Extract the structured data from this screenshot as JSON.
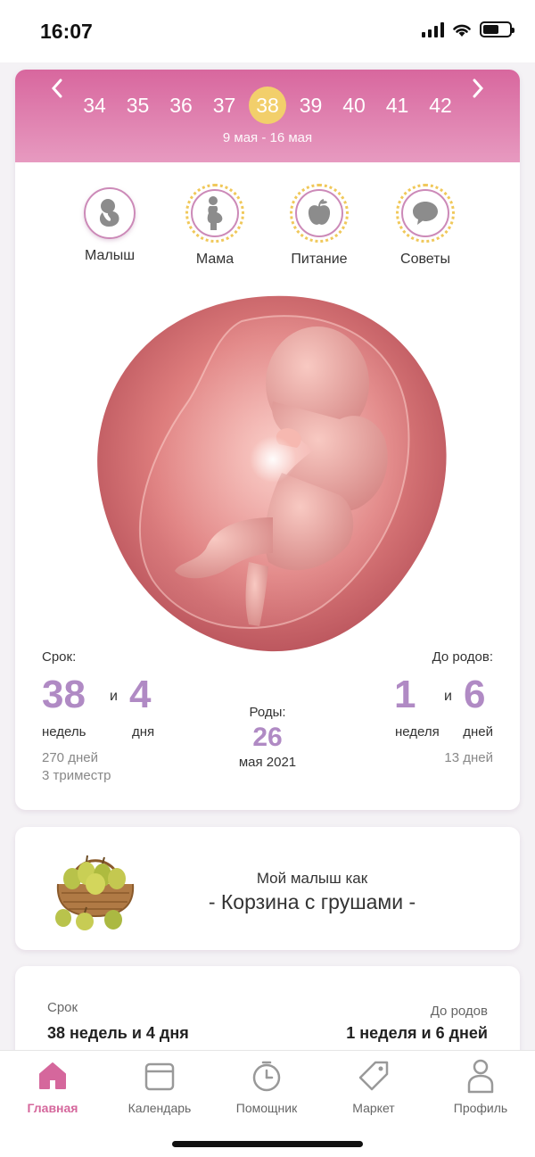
{
  "status": {
    "time": "16:07"
  },
  "weeks": {
    "items": [
      "34",
      "35",
      "36",
      "37",
      "38",
      "39",
      "40",
      "41",
      "42"
    ],
    "active": "38",
    "dates": "9 мая - 16 мая"
  },
  "tabs": [
    {
      "label": "Малыш",
      "icon": "baby-icon"
    },
    {
      "label": "Мама",
      "icon": "pregnant-woman-icon"
    },
    {
      "label": "Питание",
      "icon": "apple-icon"
    },
    {
      "label": "Советы",
      "icon": "speech-bubble-icon"
    }
  ],
  "term": {
    "label": "Срок:",
    "weeks": "38",
    "weeks_unit": "недель",
    "and": "и",
    "days": "4",
    "days_unit": "дня",
    "total_days": "270 дней",
    "trimester": "3 триместр"
  },
  "birth": {
    "label": "Роды:",
    "day": "26",
    "month_year": "мая 2021"
  },
  "remaining": {
    "label": "До родов:",
    "weeks": "1",
    "weeks_unit": "неделя",
    "and": "и",
    "days": "6",
    "days_unit": "дней",
    "total_days": "13 дней"
  },
  "fruit": {
    "subtitle": "Мой малыш как",
    "title": "- Корзина с грушами -"
  },
  "summary": {
    "term_label": "Срок",
    "term_value": "38 недель и 4 дня",
    "remaining_label": "До родов",
    "remaining_value": "1 неделя и 6 дней"
  },
  "nav": [
    {
      "label": "Главная",
      "icon": "home-icon",
      "active": true
    },
    {
      "label": "Календарь",
      "icon": "calendar-icon"
    },
    {
      "label": "Помощник",
      "icon": "timer-icon"
    },
    {
      "label": "Маркет",
      "icon": "tag-icon"
    },
    {
      "label": "Профиль",
      "icon": "profile-icon"
    }
  ],
  "colors": {
    "accent": "#d5679c",
    "number": "#b08ac4",
    "highlight": "#f2cf6b"
  }
}
